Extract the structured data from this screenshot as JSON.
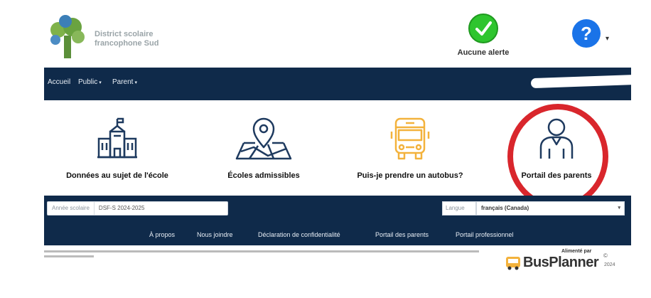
{
  "header": {
    "org_name_line1": "District scolaire",
    "org_name_line2": "francophone Sud",
    "alert_label": "Aucune alerte",
    "help_label": "?"
  },
  "nav": {
    "items": [
      {
        "label": "Accueil"
      },
      {
        "label": "Public"
      },
      {
        "label": "Parent"
      }
    ]
  },
  "tiles": [
    {
      "label": "Données au sujet de l'école",
      "icon": "school-icon"
    },
    {
      "label": "Écoles admissibles",
      "icon": "map-pin-icon"
    },
    {
      "label": "Puis-je prendre un autobus?",
      "icon": "bus-icon"
    },
    {
      "label": "Portail des parents",
      "icon": "parent-user-icon"
    }
  ],
  "footer": {
    "school_year_label": "Année scolaire",
    "school_year_value": "DSF-S 2024-2025",
    "language_label": "Langue",
    "language_value": "français (Canada)",
    "links": [
      {
        "label": "À propos"
      },
      {
        "label": "Nous joindre"
      },
      {
        "label": "Déclaration de confidentialité"
      },
      {
        "label": "Portail des parents"
      },
      {
        "label": "Portail professionnel"
      }
    ]
  },
  "branding": {
    "powered_by": "Alimenté par",
    "product": "BusPlanner",
    "copyright": "©",
    "year": "2024"
  },
  "colors": {
    "navbar": "#0f2a4a",
    "alert_green": "#2ec52e",
    "help_blue": "#1a73e8",
    "bus_yellow": "#f3b23c",
    "icon_navy": "#1e3a5f",
    "highlight_red": "#d9262c"
  }
}
